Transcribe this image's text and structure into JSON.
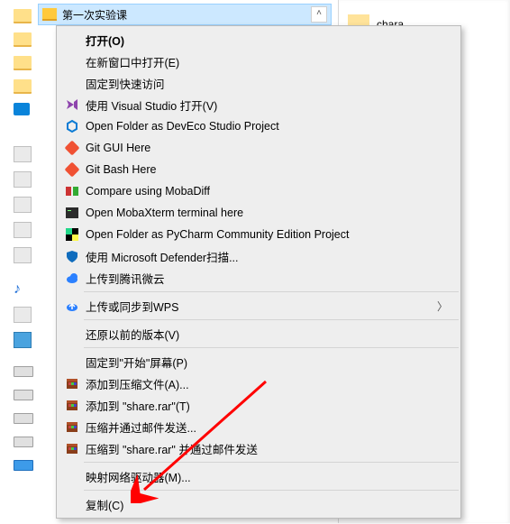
{
  "selected_folder": {
    "name": "第一次实验课"
  },
  "right_panel": {
    "folder_name": "chara"
  },
  "menu": {
    "open": "打开(O)",
    "open_new_window": "在新窗口中打开(E)",
    "pin_quick_access": "固定到快速访问",
    "visual_studio": "使用 Visual Studio 打开(V)",
    "deveco": "Open Folder as DevEco Studio Project",
    "git_gui": "Git GUI Here",
    "git_bash": "Git Bash Here",
    "mobadiff": "Compare using MobaDiff",
    "mobaxterm": "Open MobaXterm terminal here",
    "pycharm": "Open Folder as PyCharm Community Edition Project",
    "defender": "使用 Microsoft Defender扫描...",
    "tencent_cloud": "上传到腾讯微云",
    "wps_sync": "上传或同步到WPS",
    "previous_versions": "还原以前的版本(V)",
    "pin_start": "固定到\"开始\"屏幕(P)",
    "add_archive": "添加到压缩文件(A)...",
    "add_to_share_rar": "添加到 \"share.rar\"(T)",
    "compress_email": "压缩并通过邮件发送...",
    "compress_share_email": "压缩到 \"share.rar\" 并通过邮件发送",
    "map_network_drive": "映射网络驱动器(M)...",
    "copy": "复制(C)"
  },
  "icons": {
    "vs_color": "#8e44ad",
    "deveco_color": "#0b7bd4",
    "git_color": "#f05133",
    "moba_color": "#3b3b3b",
    "pycharm_color1": "#21d789",
    "pycharm_color2": "#fcf84a",
    "defender_color": "#0f6cbd",
    "tencent_color": "#2b80ff",
    "wps_color": "#2b80ff",
    "winrar1": "#8a3e1a",
    "winrar2": "#3e8a1a",
    "winrar3": "#1a3e8a"
  }
}
